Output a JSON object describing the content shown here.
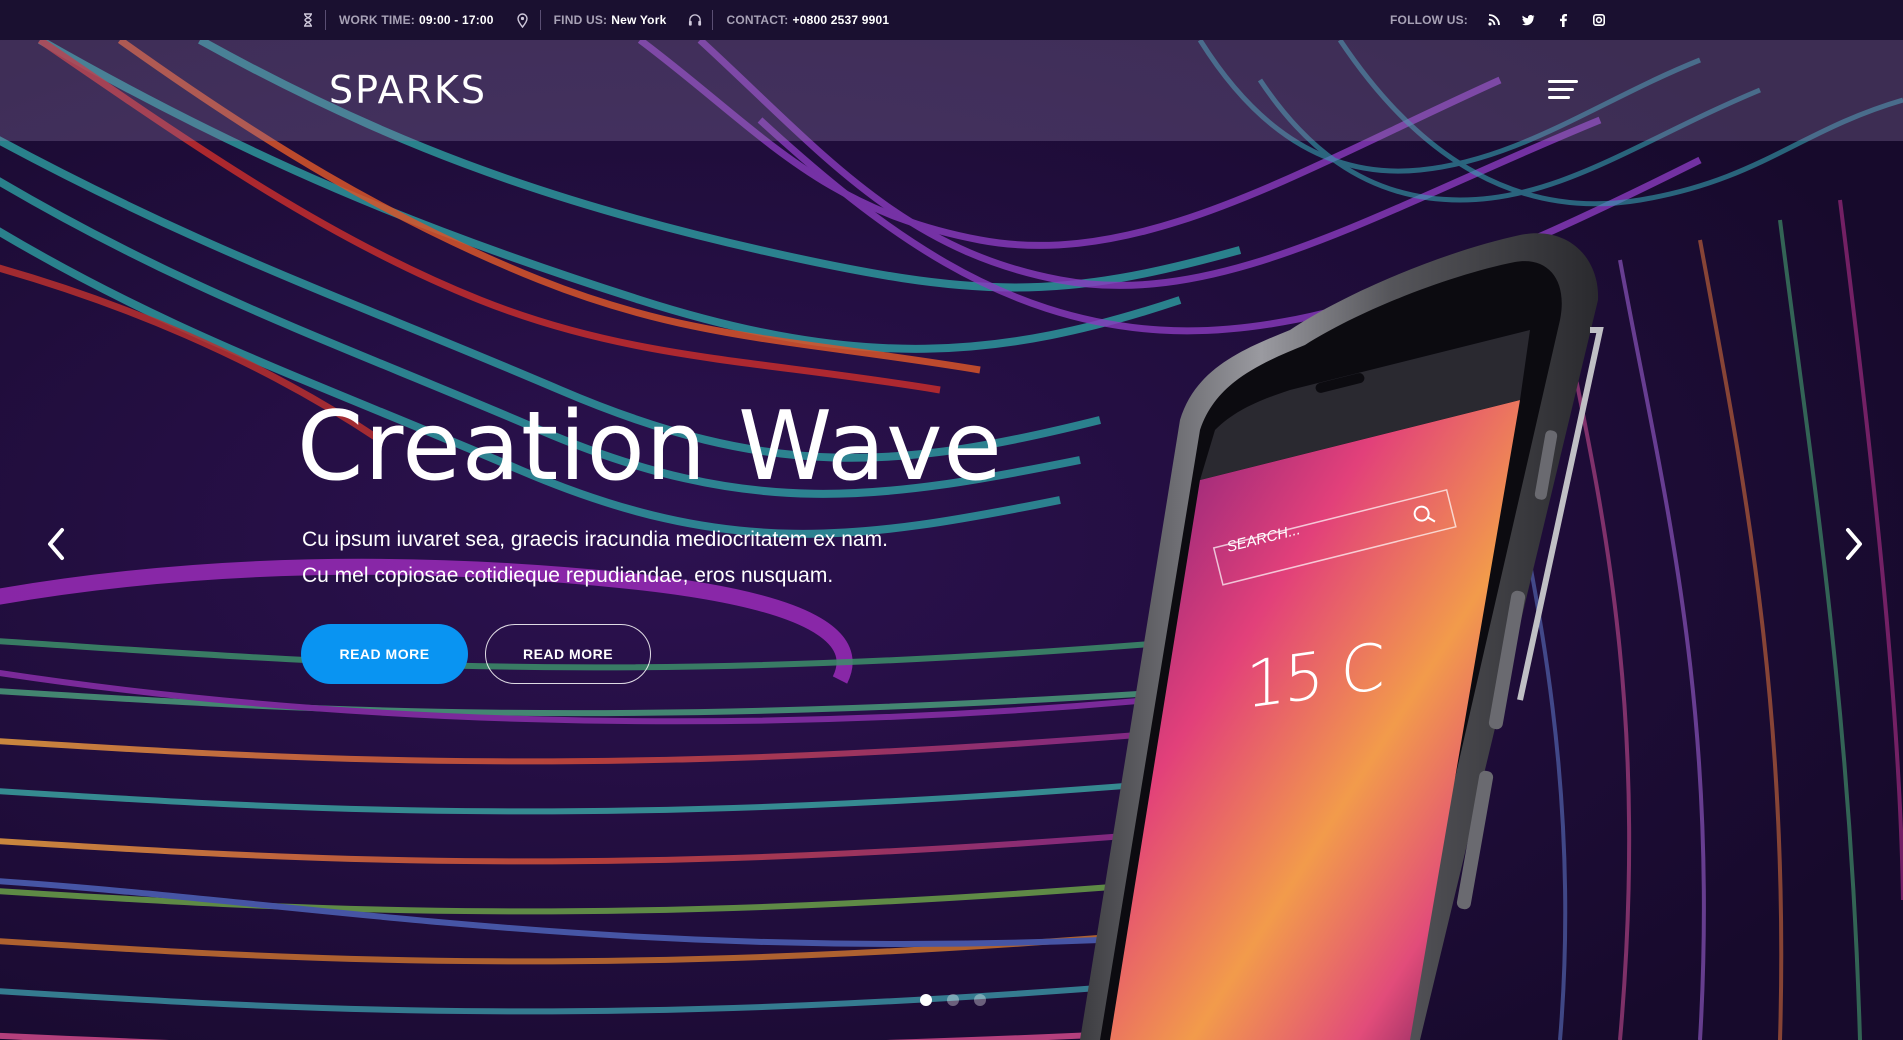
{
  "topbar": {
    "work_time_label": "WORK TIME:",
    "work_time_value": "09:00 - 17:00",
    "find_us_label": "FIND US:",
    "find_us_value": "New York",
    "contact_label": "CONTACT:",
    "contact_value": "+0800 2537 9901",
    "follow_label": "FOLLOW US:",
    "icons": [
      "hourglass-icon",
      "location-pin-icon",
      "headset-icon"
    ],
    "social": [
      "rss-icon",
      "twitter-icon",
      "facebook-icon",
      "instagram-icon"
    ]
  },
  "nav": {
    "logo": "SPARKS",
    "menu_icon": "hamburger-menu-icon"
  },
  "hero": {
    "title": "Creation Wave",
    "line1": "Cu ipsum iuvaret sea, graecis iracundia mediocritatem ex nam.",
    "line2": "Cu mel copiosae cotidieque repudiandae, eros nusquam.",
    "primary_button": "READ MORE",
    "secondary_button": "READ MORE",
    "phone_screen": {
      "search_placeholder": "SEARCH...",
      "temperature": "15 C"
    }
  },
  "slider": {
    "slide_count": 3,
    "active_slide": 1
  },
  "colors": {
    "topbar_bg": "#1a1030",
    "hero_bg": "#200c3c",
    "primary_button": "#0994f2",
    "text_muted": "#a8a2b6"
  }
}
